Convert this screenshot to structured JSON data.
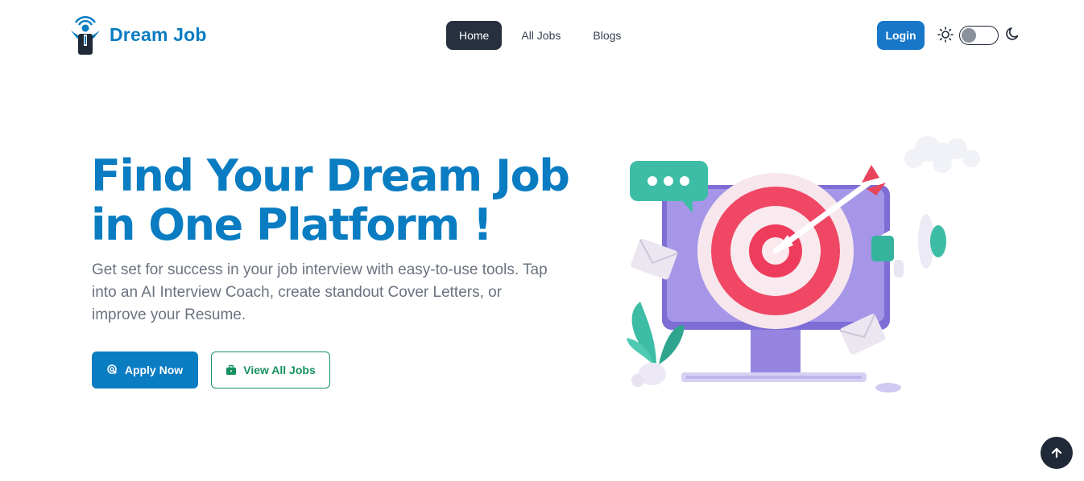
{
  "brand": {
    "name": "Dream Job",
    "logo_icon": "person-broadcast-logo"
  },
  "nav": {
    "items": [
      {
        "label": "Home",
        "active": true
      },
      {
        "label": "All Jobs",
        "active": false
      },
      {
        "label": "Blogs",
        "active": false
      }
    ],
    "login_label": "Login",
    "theme": {
      "light_icon": "sun-icon",
      "dark_icon": "moon-icon",
      "dark_mode": false
    }
  },
  "hero": {
    "title_line1": "Find Your Dream Job",
    "title_line2": "in One Platform !",
    "subtitle": "Get set for success in your job interview with easy-to-use tools. Tap into an AI Interview Coach, create standout Cover Letters, or improve your Resume.",
    "apply_label": "Apply Now",
    "apply_icon": "target-click-icon",
    "view_jobs_label": "View All Jobs",
    "view_jobs_icon": "briefcase-icon"
  },
  "colors": {
    "brand_blue": "#0a7cc2",
    "nav_active_bg": "#27303e",
    "login_blue": "#1877c9",
    "view_green": "#17915f",
    "subtitle_gray": "#6b7280"
  },
  "scroll_top_icon": "arrow-up-icon"
}
